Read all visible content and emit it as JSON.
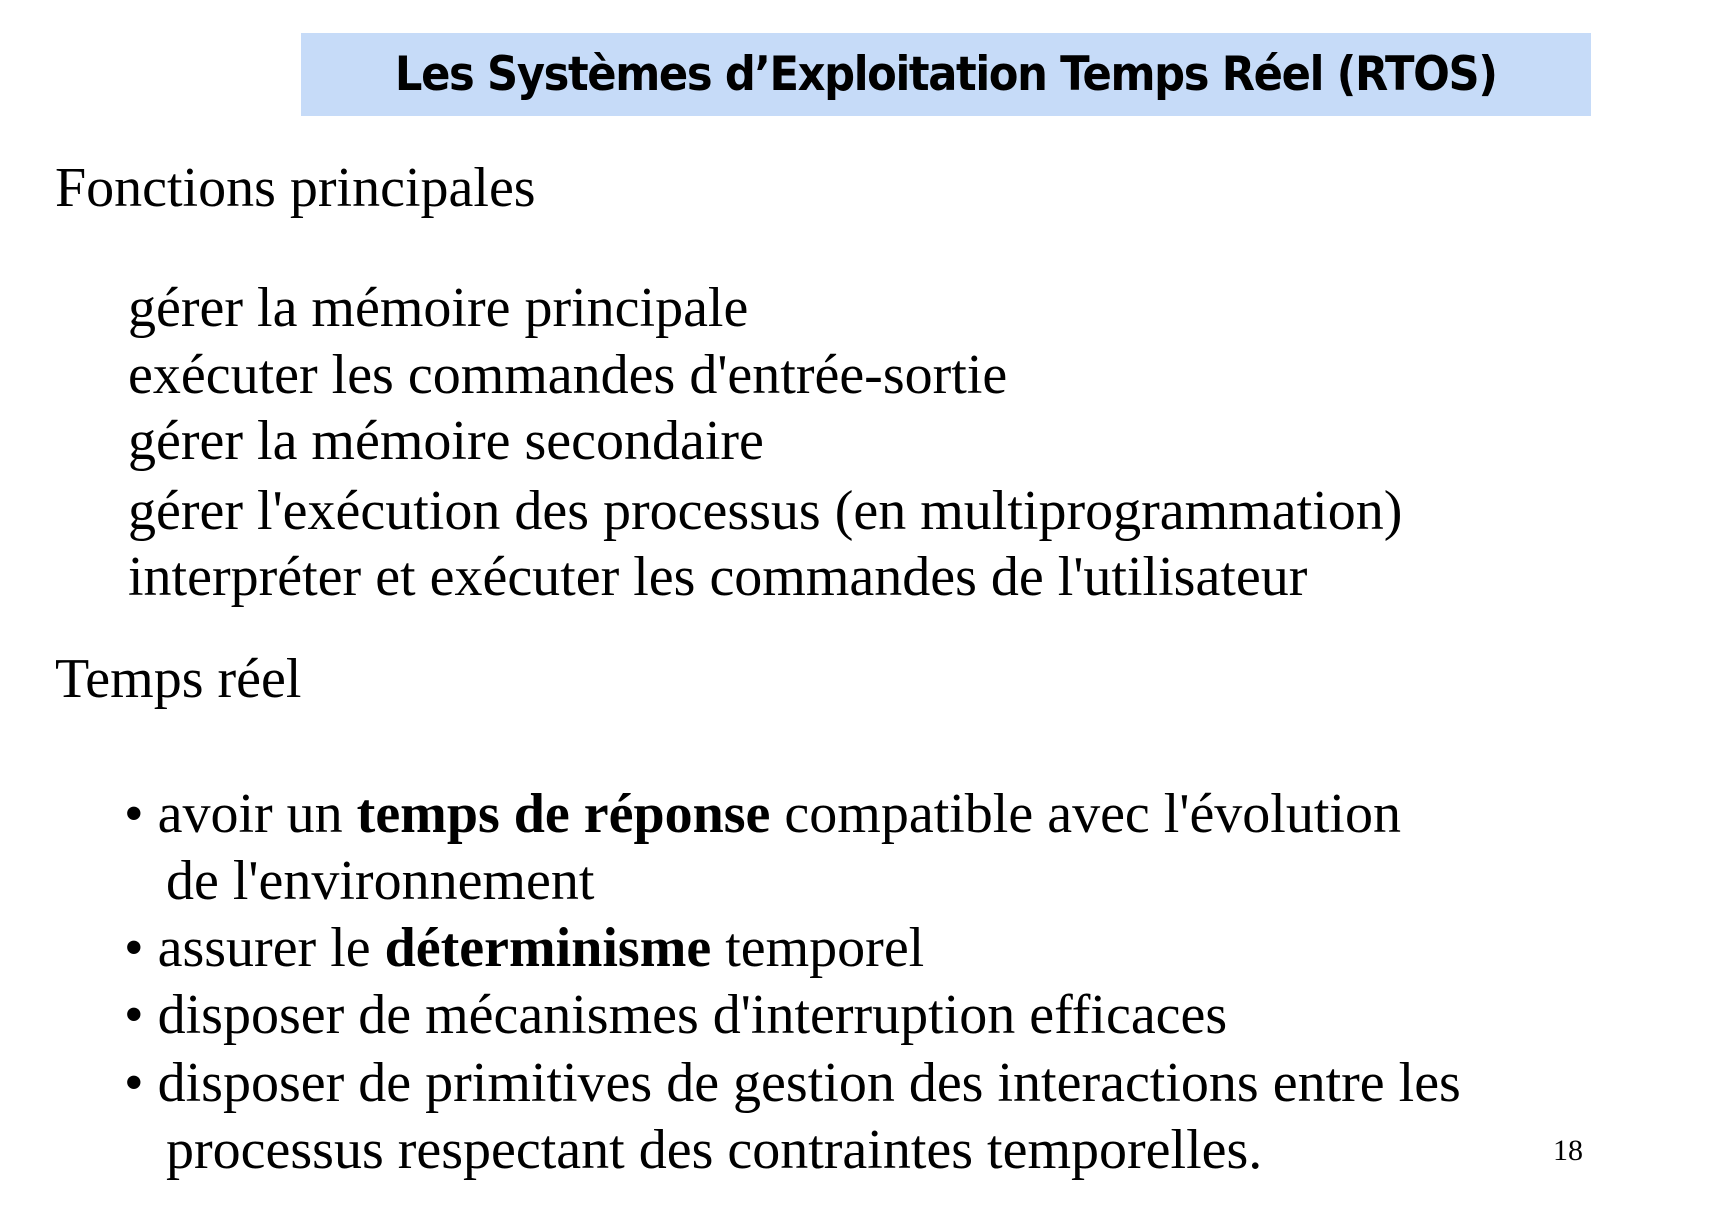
{
  "slide": {
    "title": "Les Systèmes d’Exploitation Temps Réel (RTOS)",
    "title_bg_color": "#c6dbf8",
    "section1": {
      "heading": "Fonctions principales",
      "items": [
        "gérer la mémoire principale",
        "exécuter les commandes d'entrée-sortie",
        "gérer la mémoire secondaire",
        "gérer l'exécution des processus (en multiprogrammation)",
        "interpréter et exécuter les commandes de l'utilisateur"
      ]
    },
    "section2": {
      "heading": "Temps réel",
      "bullet_symbol": "•",
      "bullets": [
        {
          "before": "avoir un ",
          "bold": "temps de réponse",
          "after": " compatible avec l'évolution",
          "continuation": "de l'environnement"
        },
        {
          "before": "assurer le ",
          "bold": "déterminisme",
          "after": " temporel"
        },
        {
          "text": "disposer de mécanismes d'interruption efficaces"
        },
        {
          "text": "disposer de primitives de gestion des interactions entre les",
          "continuation": "processus respectant des contraintes temporelles."
        }
      ]
    },
    "page_number": "18"
  }
}
